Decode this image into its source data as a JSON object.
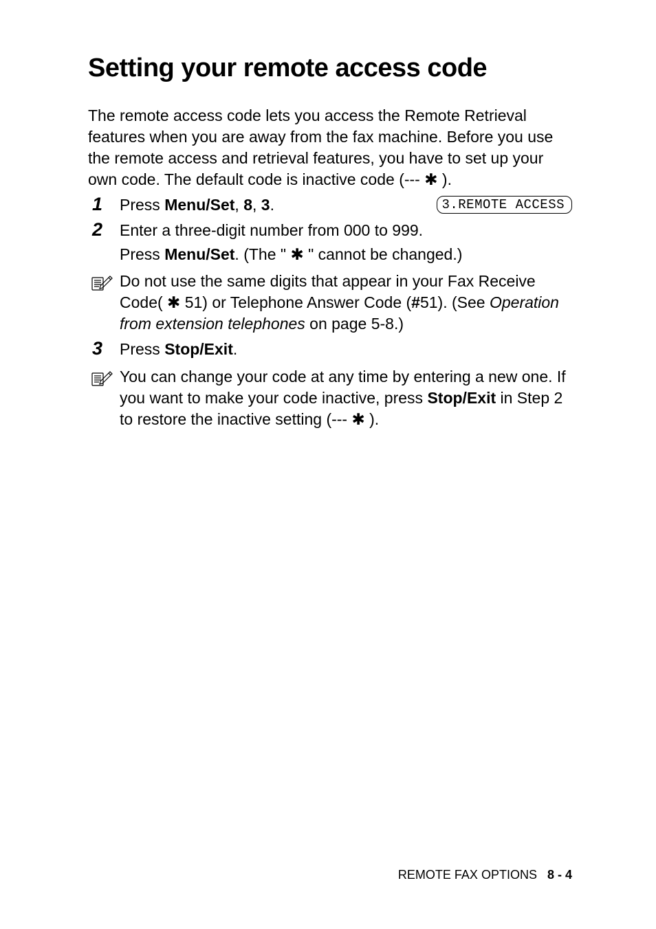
{
  "title": "Setting your remote access code",
  "intro": {
    "line1": "The remote access code lets you access the Remote Retrieval features when you are away from the fax machine. Before you use the remote access and retrieval features, you have to set up your own code. The default code is inactive code (--- ",
    "star": "✱",
    "line1_end": " )."
  },
  "steps": {
    "s1": {
      "num": "1",
      "pre": "Press ",
      "menuset": "Menu/Set",
      "mid1": ", ",
      "eight": "8",
      "mid2": ", ",
      "three": "3",
      "end": "."
    },
    "lcd": "3.REMOTE ACCESS",
    "s2": {
      "num": "2",
      "line1": "Enter a three-digit number from 000 to 999.",
      "line2_pre": "Press ",
      "line2_ms": "Menu/Set",
      "line2_mid": ". (The \" ",
      "line2_star": "✱",
      "line2_end": " \" cannot be changed.)"
    },
    "note1": {
      "l1": "Do not use the same digits that appear in your Fax Receive Code( ",
      "star": "✱",
      "l2": " 51) or Telephone Answer Code (",
      "hash": "#",
      "l3": "51). (See ",
      "ital": "Operation from extension telephones",
      "l4": " on page 5-8.)"
    },
    "s3": {
      "num": "3",
      "pre": "Press ",
      "se": "Stop/Exit",
      "end": "."
    },
    "note2": {
      "l1": "You can change your code at any time by entering a new one. If you want to make your code inactive, press ",
      "se": "Stop/Exit",
      "l2": " in Step 2 to restore the inactive setting (--- ",
      "star": "✱",
      "l3": " )."
    }
  },
  "footer": {
    "label": "REMOTE FAX OPTIONS",
    "page": "8 - 4"
  }
}
